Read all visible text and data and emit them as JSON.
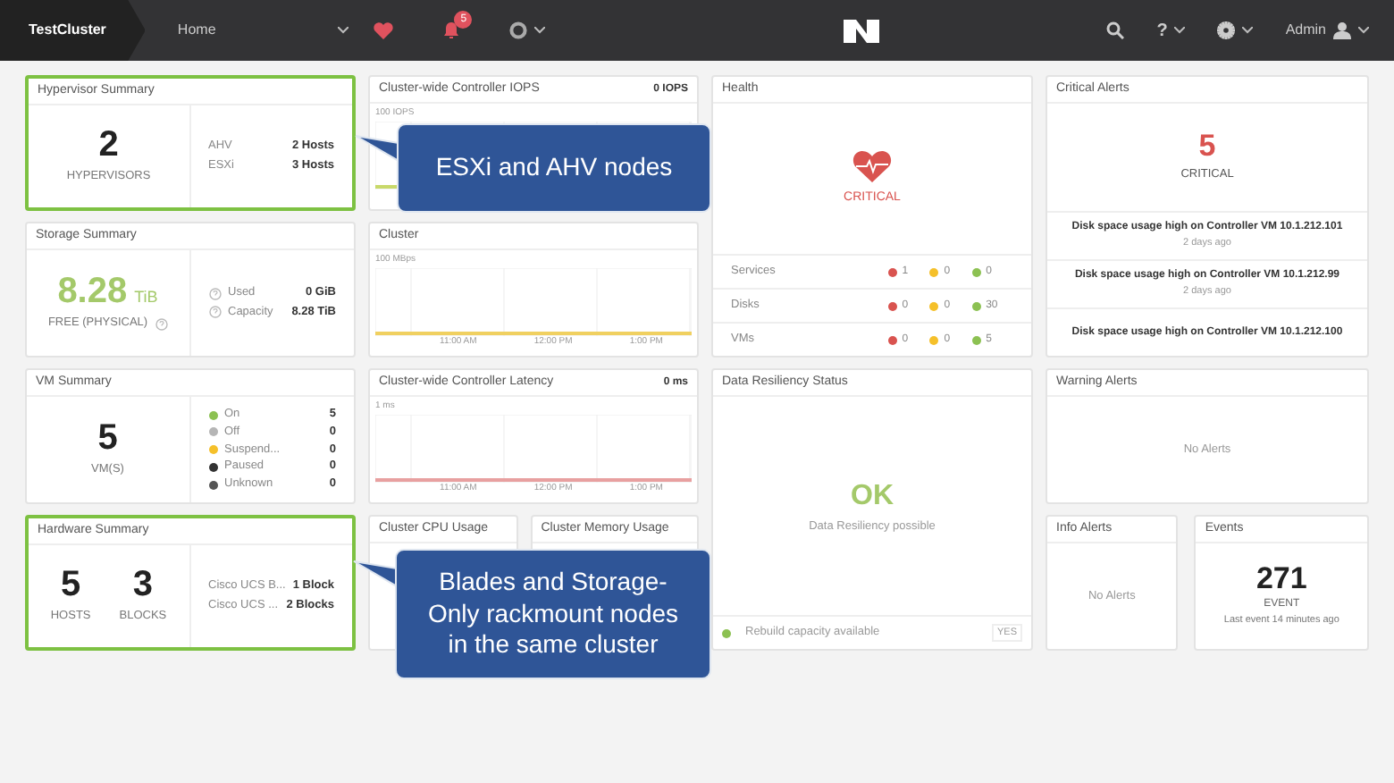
{
  "navbar": {
    "cluster_name": "TestCluster",
    "page": "Home",
    "alert_count": "5",
    "help": "?",
    "user": "Admin"
  },
  "hypervisor_summary": {
    "title": "Hypervisor Summary",
    "highlighted": true,
    "count": "2",
    "count_label": "HYPERVISORS",
    "rows": [
      {
        "name": "AHV",
        "value": "2 Hosts"
      },
      {
        "name": "ESXi",
        "value": "3 Hosts"
      }
    ]
  },
  "storage_summary": {
    "title": "Storage Summary",
    "value": "8.28",
    "unit": "TiB",
    "label": "FREE (PHYSICAL)",
    "rows": [
      {
        "name": "Used",
        "value": "0 GiB"
      },
      {
        "name": "Capacity",
        "value": "8.28 TiB"
      }
    ]
  },
  "vm_summary": {
    "title": "VM Summary",
    "count": "5",
    "count_label": "VM(S)",
    "states": [
      {
        "name": "On",
        "value": "5",
        "color": "#8cc152"
      },
      {
        "name": "Off",
        "value": "0",
        "color": "#b5b5b5"
      },
      {
        "name": "Suspend...",
        "value": "0",
        "color": "#f5c02a"
      },
      {
        "name": "Paused",
        "value": "0",
        "color": "#333333"
      },
      {
        "name": "Unknown",
        "value": "0",
        "color": "#555555"
      }
    ]
  },
  "hardware_summary": {
    "title": "Hardware Summary",
    "highlighted": true,
    "stats": [
      {
        "value": "5",
        "label": "HOSTS"
      },
      {
        "value": "3",
        "label": "BLOCKS"
      }
    ],
    "rows": [
      {
        "name": "Cisco UCS B...",
        "value": "1 Block"
      },
      {
        "name": "Cisco UCS ...",
        "value": "2 Blocks"
      }
    ]
  },
  "charts": [
    {
      "title": "Cluster-wide Controller IOPS",
      "reading": "0 IOPS",
      "y_tick": "100 IOPS",
      "color": "#c8d96a"
    },
    {
      "title": "Cluster",
      "y_tick": "100 MBps",
      "x_ticks": [
        "11:00 AM",
        "12:00 PM",
        "1:00 PM"
      ],
      "color": "#f0d060"
    },
    {
      "title": "Cluster-wide Controller Latency",
      "reading": "0 ms",
      "y_tick": "1 ms",
      "x_ticks": [
        "11:00 AM",
        "12:00 PM",
        "1:00 PM"
      ],
      "color": "#e8a0a0"
    }
  ],
  "usage_panels": [
    {
      "title": "Cluster CPU Usage"
    },
    {
      "title": "Cluster Memory Usage"
    }
  ],
  "health": {
    "title": "Health",
    "status": "CRITICAL",
    "rows": [
      {
        "name": "Services",
        "counts": [
          {
            "value": "1",
            "color": "#d9534f"
          },
          {
            "value": "0",
            "color": "#f5c02a"
          },
          {
            "value": "0",
            "color": "#8cc152"
          }
        ]
      },
      {
        "name": "Disks",
        "counts": [
          {
            "value": "0",
            "color": "#d9534f"
          },
          {
            "value": "0",
            "color": "#f5c02a"
          },
          {
            "value": "30",
            "color": "#8cc152"
          }
        ]
      },
      {
        "name": "VMs",
        "counts": [
          {
            "value": "0",
            "color": "#d9534f"
          },
          {
            "value": "0",
            "color": "#f5c02a"
          },
          {
            "value": "5",
            "color": "#8cc152"
          }
        ]
      }
    ]
  },
  "critical_alerts": {
    "title": "Critical Alerts",
    "count": "5",
    "label": "CRITICAL",
    "alerts": [
      {
        "message": "Disk space usage high on Controller VM 10.1.212.101",
        "time": "2 days ago"
      },
      {
        "message": "Disk space usage high on Controller VM 10.1.212.99",
        "time": "2 days ago"
      },
      {
        "message": "Disk space usage high on Controller VM 10.1.212.100"
      }
    ]
  },
  "data_resiliency": {
    "title": "Data Resiliency Status",
    "status": "OK",
    "message": "Data Resiliency possible",
    "footer_text": "Rebuild capacity available",
    "footer_value": "YES"
  },
  "warning_alerts": {
    "title": "Warning Alerts",
    "message": "No Alerts"
  },
  "info_alerts": {
    "title": "Info Alerts",
    "message": "No Alerts"
  },
  "events": {
    "title": "Events",
    "count": "271",
    "label": "EVENT",
    "detail": "Last event 14 minutes ago"
  },
  "callouts": [
    {
      "text": "ESXi and AHV nodes"
    },
    {
      "text": "Blades and Storage-Only rackmount nodes in the same cluster"
    }
  ]
}
